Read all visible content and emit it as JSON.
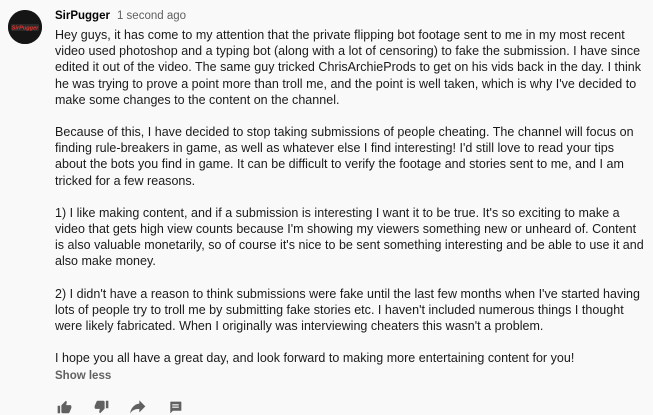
{
  "comment": {
    "author": "SirPugger",
    "timestamp": "1 second ago",
    "avatar_text": "SirPugger",
    "paragraphs": [
      "Hey guys, it has come to my attention that the private flipping bot footage sent to me in my most recent video used photoshop and a typing bot (along with a lot of censoring) to fake the submission. I have since edited it out of the video. The same guy tricked ChrisArchieProds to get on his vids back in the day. I think he was trying to prove a point more than troll me, and the point is well taken, which is why I've decided to make some changes to the content on the channel.",
      "Because of this, I have decided to stop taking submissions of people cheating. The channel will focus on finding rule-breakers in game, as well as whatever else I find interesting! I'd still love to read your tips about the bots you find in game. It can be difficult to verify the footage and stories sent to me, and I am tricked for a few reasons.",
      "1) I like making content, and if a submission is interesting I want it to be true. It's so exciting to make a video that gets high view counts because I'm showing my viewers something new or unheard of. Content is also valuable monetarily, so of course it's nice to be sent something interesting and be able to use it and also make money.",
      "2) I didn't have a reason to think submissions were fake until the last few months when I've started having lots of people try to troll me by submitting fake stories etc. I haven't included numerous things I thought were likely fabricated. When I originally was interviewing cheaters this wasn't a problem.",
      "I hope you all have a great day, and look forward to making more entertaining content for you!"
    ],
    "show_less_label": "Show less"
  },
  "actions": {
    "like_icon": "thumbs-up-icon",
    "dislike_icon": "thumbs-down-icon",
    "share_icon": "share-icon",
    "reply_icon": "comment-icon"
  },
  "colors": {
    "background": "#f9f9f9",
    "text": "#1a1a1a",
    "muted": "#606060",
    "avatar_bg": "#1a1a1a",
    "avatar_text": "#e8322c"
  }
}
